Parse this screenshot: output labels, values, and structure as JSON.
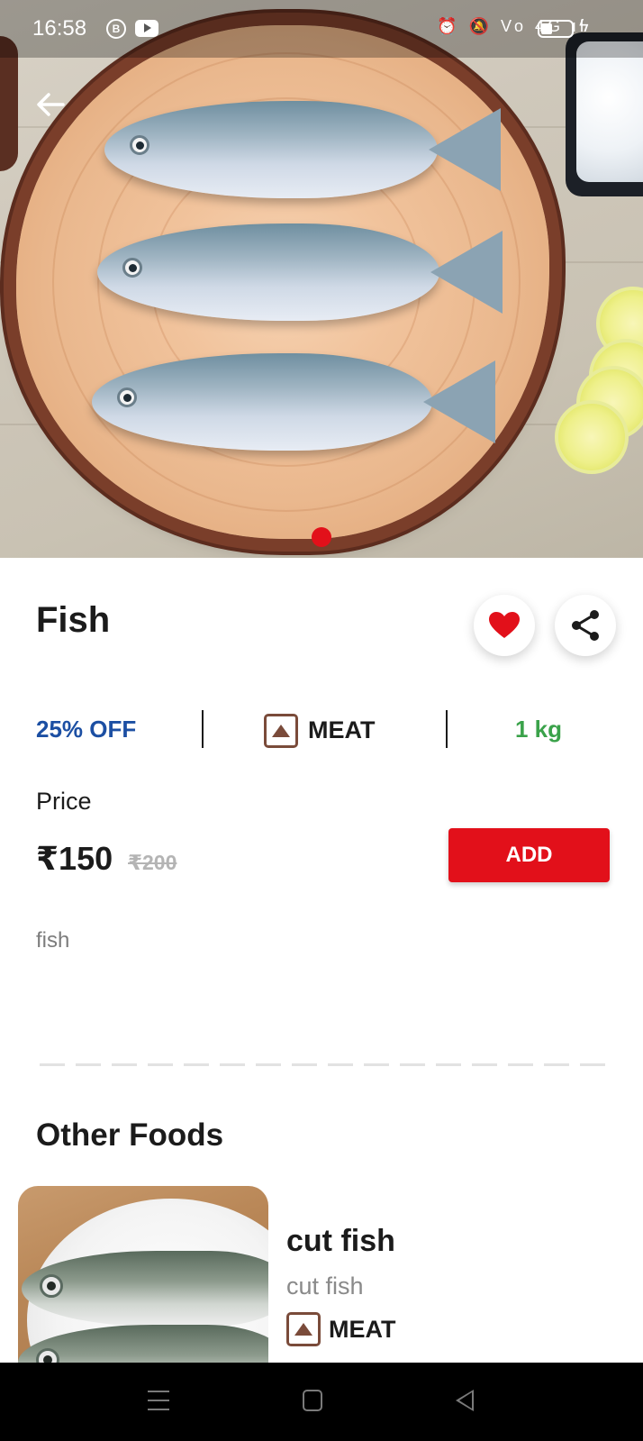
{
  "status_bar": {
    "time": "16:58",
    "badge_b": "B",
    "right_icons": "⏰ 🔕 Vo 4G ıl"
  },
  "product": {
    "name": "Fish",
    "discount": "25% OFF",
    "category": "MEAT",
    "quantity": "1 kg",
    "price_label": "Price",
    "price": "₹150",
    "mrp": "₹200",
    "add_label": "ADD",
    "description": "fish"
  },
  "other_foods": {
    "title": "Other Foods",
    "items": [
      {
        "name": "cut fish",
        "description": "cut fish",
        "category": "MEAT"
      }
    ]
  },
  "colors": {
    "accent_red": "#e2101a",
    "discount_blue": "#1c4fa3",
    "quantity_green": "#3aa24a",
    "nonveg_brown": "#7a4b3a"
  },
  "icons": [
    "back-arrow-icon",
    "heart-icon",
    "share-icon",
    "nonveg-mark-icon",
    "menu-icon",
    "home-icon",
    "back-nav-icon"
  ]
}
